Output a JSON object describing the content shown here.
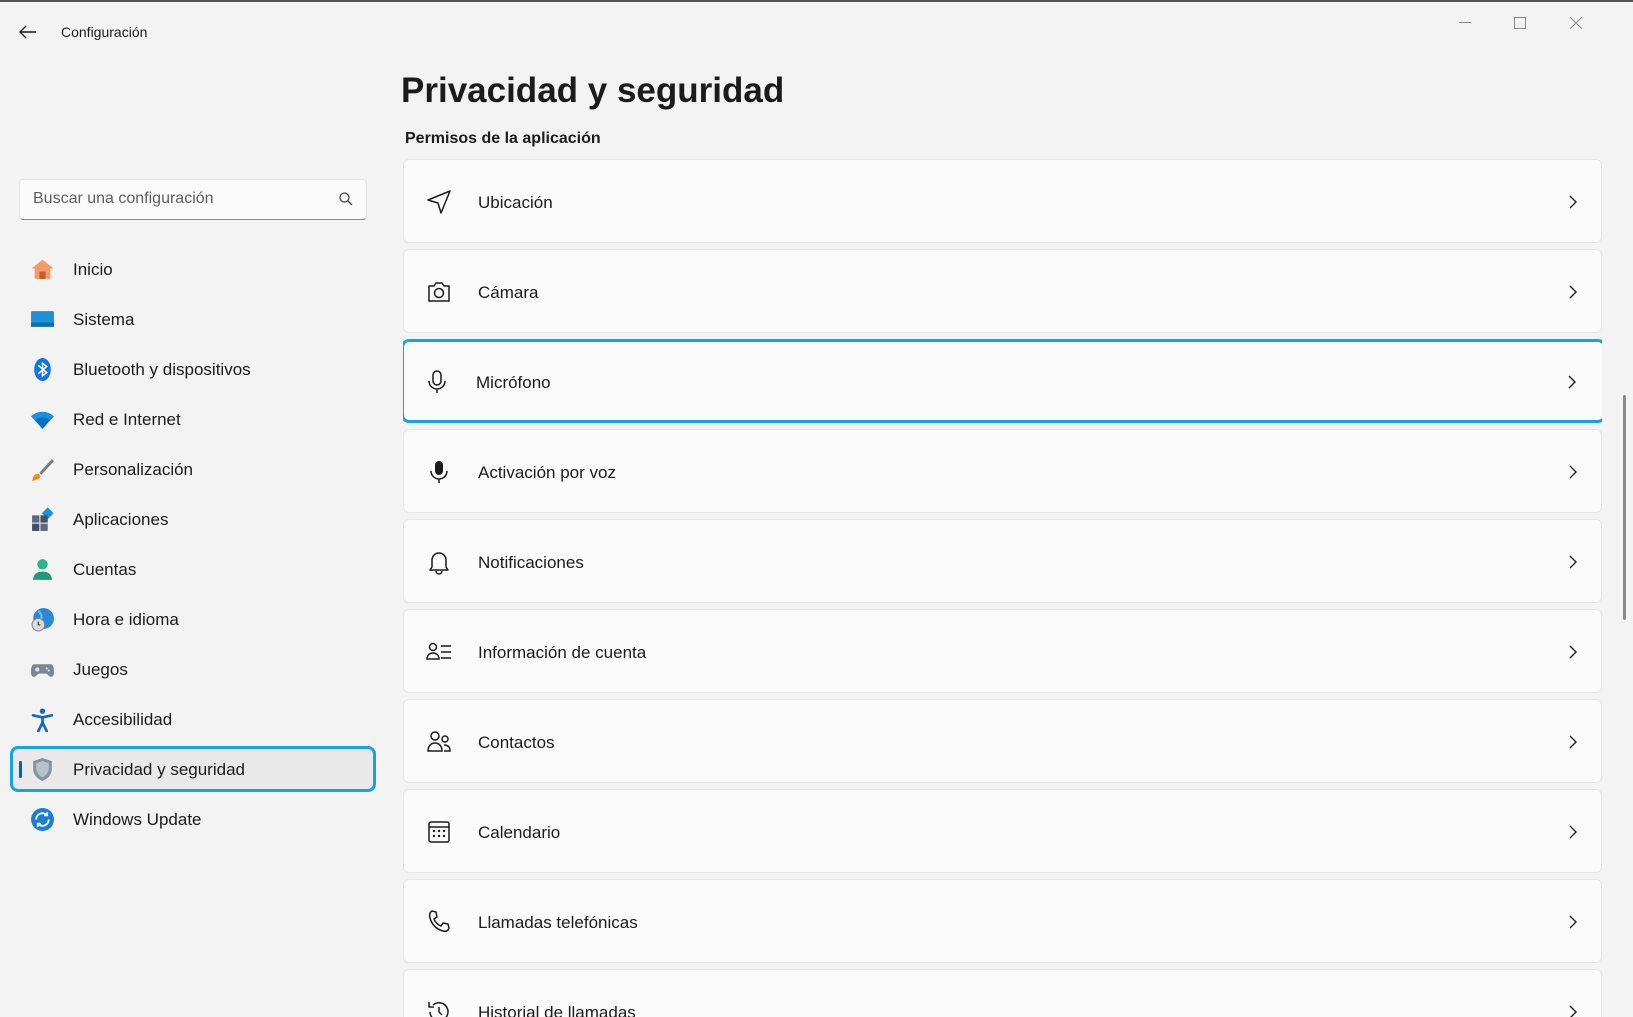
{
  "window": {
    "title": "Configuración",
    "controls": [
      "minimize-icon",
      "maximize-icon",
      "close-icon"
    ]
  },
  "search": {
    "placeholder": "Buscar una configuración"
  },
  "sidebar": {
    "items": [
      {
        "label": "Inicio",
        "icon": "home-icon"
      },
      {
        "label": "Sistema",
        "icon": "system-icon"
      },
      {
        "label": "Bluetooth y dispositivos",
        "icon": "bluetooth-icon"
      },
      {
        "label": "Red e Internet",
        "icon": "wifi-icon"
      },
      {
        "label": "Personalización",
        "icon": "brush-icon"
      },
      {
        "label": "Aplicaciones",
        "icon": "apps-icon"
      },
      {
        "label": "Cuentas",
        "icon": "account-icon"
      },
      {
        "label": "Hora e idioma",
        "icon": "time-language-icon"
      },
      {
        "label": "Juegos",
        "icon": "gamepad-icon"
      },
      {
        "label": "Accesibilidad",
        "icon": "accessibility-icon"
      },
      {
        "label": "Privacidad y seguridad",
        "icon": "shield-icon",
        "selected": true
      },
      {
        "label": "Windows Update",
        "icon": "update-icon"
      }
    ]
  },
  "main": {
    "title": "Privacidad y seguridad",
    "section": "Permisos de la aplicación",
    "permissions": [
      {
        "label": "Ubicación",
        "icon": "location-icon"
      },
      {
        "label": "Cámara",
        "icon": "camera-icon"
      },
      {
        "label": "Micrófono",
        "icon": "microphone-icon",
        "focused": true
      },
      {
        "label": "Activación por voz",
        "icon": "voice-activation-icon"
      },
      {
        "label": "Notificaciones",
        "icon": "bell-icon"
      },
      {
        "label": "Información de cuenta",
        "icon": "account-info-icon"
      },
      {
        "label": "Contactos",
        "icon": "contacts-icon"
      },
      {
        "label": "Calendario",
        "icon": "calendar-icon"
      },
      {
        "label": "Llamadas telefónicas",
        "icon": "phone-icon"
      },
      {
        "label": "Historial de llamadas",
        "icon": "call-history-icon"
      }
    ]
  },
  "colors": {
    "accent": "#005fb8",
    "highlight": "#1aa0e8",
    "background": "#f3f3f3",
    "card": "#fbfbfb"
  }
}
